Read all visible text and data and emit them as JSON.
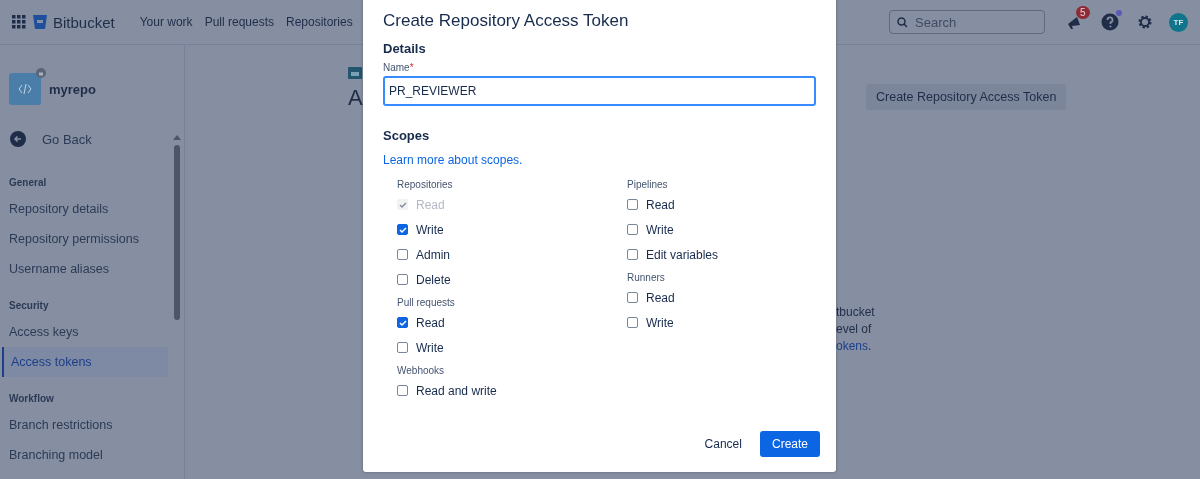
{
  "header": {
    "brand": "Bitbucket",
    "nav": [
      "Your work",
      "Pull requests",
      "Repositories"
    ],
    "search": {
      "placeholder": "Search"
    },
    "notifications_count": "5",
    "avatar_initials": "TF"
  },
  "sidebar": {
    "repo_name": "myrepo",
    "back": "Go Back",
    "sections": [
      {
        "title": "General",
        "items": [
          {
            "label": "Repository details",
            "selected": false
          },
          {
            "label": "Repository permissions",
            "selected": false
          },
          {
            "label": "Username aliases",
            "selected": false
          }
        ]
      },
      {
        "title": "Security",
        "items": [
          {
            "label": "Access keys",
            "selected": false
          },
          {
            "label": "Access tokens",
            "selected": true
          }
        ]
      },
      {
        "title": "Workflow",
        "items": [
          {
            "label": "Branch restrictions",
            "selected": false
          },
          {
            "label": "Branching model",
            "selected": false
          }
        ]
      }
    ]
  },
  "main": {
    "heading": "A",
    "create_button": "Create Repository Access Token",
    "description_lines": [
      "tbucket",
      "evel of"
    ],
    "description_link": "okens",
    "description_end": "."
  },
  "dialog": {
    "title": "Create Repository Access Token",
    "details_heading": "Details",
    "name_label": "Name",
    "name_required": "*",
    "name_value": "PR_REVIEWER",
    "scopes_heading": "Scopes",
    "learn_more": "Learn more about scopes.",
    "scope_columns": [
      [
        {
          "group": "Repositories",
          "options": [
            {
              "label": "Read",
              "checked": true,
              "disabled": true
            },
            {
              "label": "Write",
              "checked": true,
              "disabled": false
            },
            {
              "label": "Admin",
              "checked": false,
              "disabled": false
            },
            {
              "label": "Delete",
              "checked": false,
              "disabled": false
            }
          ]
        },
        {
          "group": "Pull requests",
          "options": [
            {
              "label": "Read",
              "checked": true,
              "disabled": false
            },
            {
              "label": "Write",
              "checked": false,
              "disabled": false
            }
          ]
        },
        {
          "group": "Webhooks",
          "options": [
            {
              "label": "Read and write",
              "checked": false,
              "disabled": false
            }
          ]
        }
      ],
      [
        {
          "group": "Pipelines",
          "options": [
            {
              "label": "Read",
              "checked": false,
              "disabled": false
            },
            {
              "label": "Write",
              "checked": false,
              "disabled": false
            },
            {
              "label": "Edit variables",
              "checked": false,
              "disabled": false
            }
          ]
        },
        {
          "group": "Runners",
          "options": [
            {
              "label": "Read",
              "checked": false,
              "disabled": false
            },
            {
              "label": "Write",
              "checked": false,
              "disabled": false
            }
          ]
        }
      ]
    ],
    "buttons": {
      "cancel": "Cancel",
      "create": "Create"
    }
  }
}
